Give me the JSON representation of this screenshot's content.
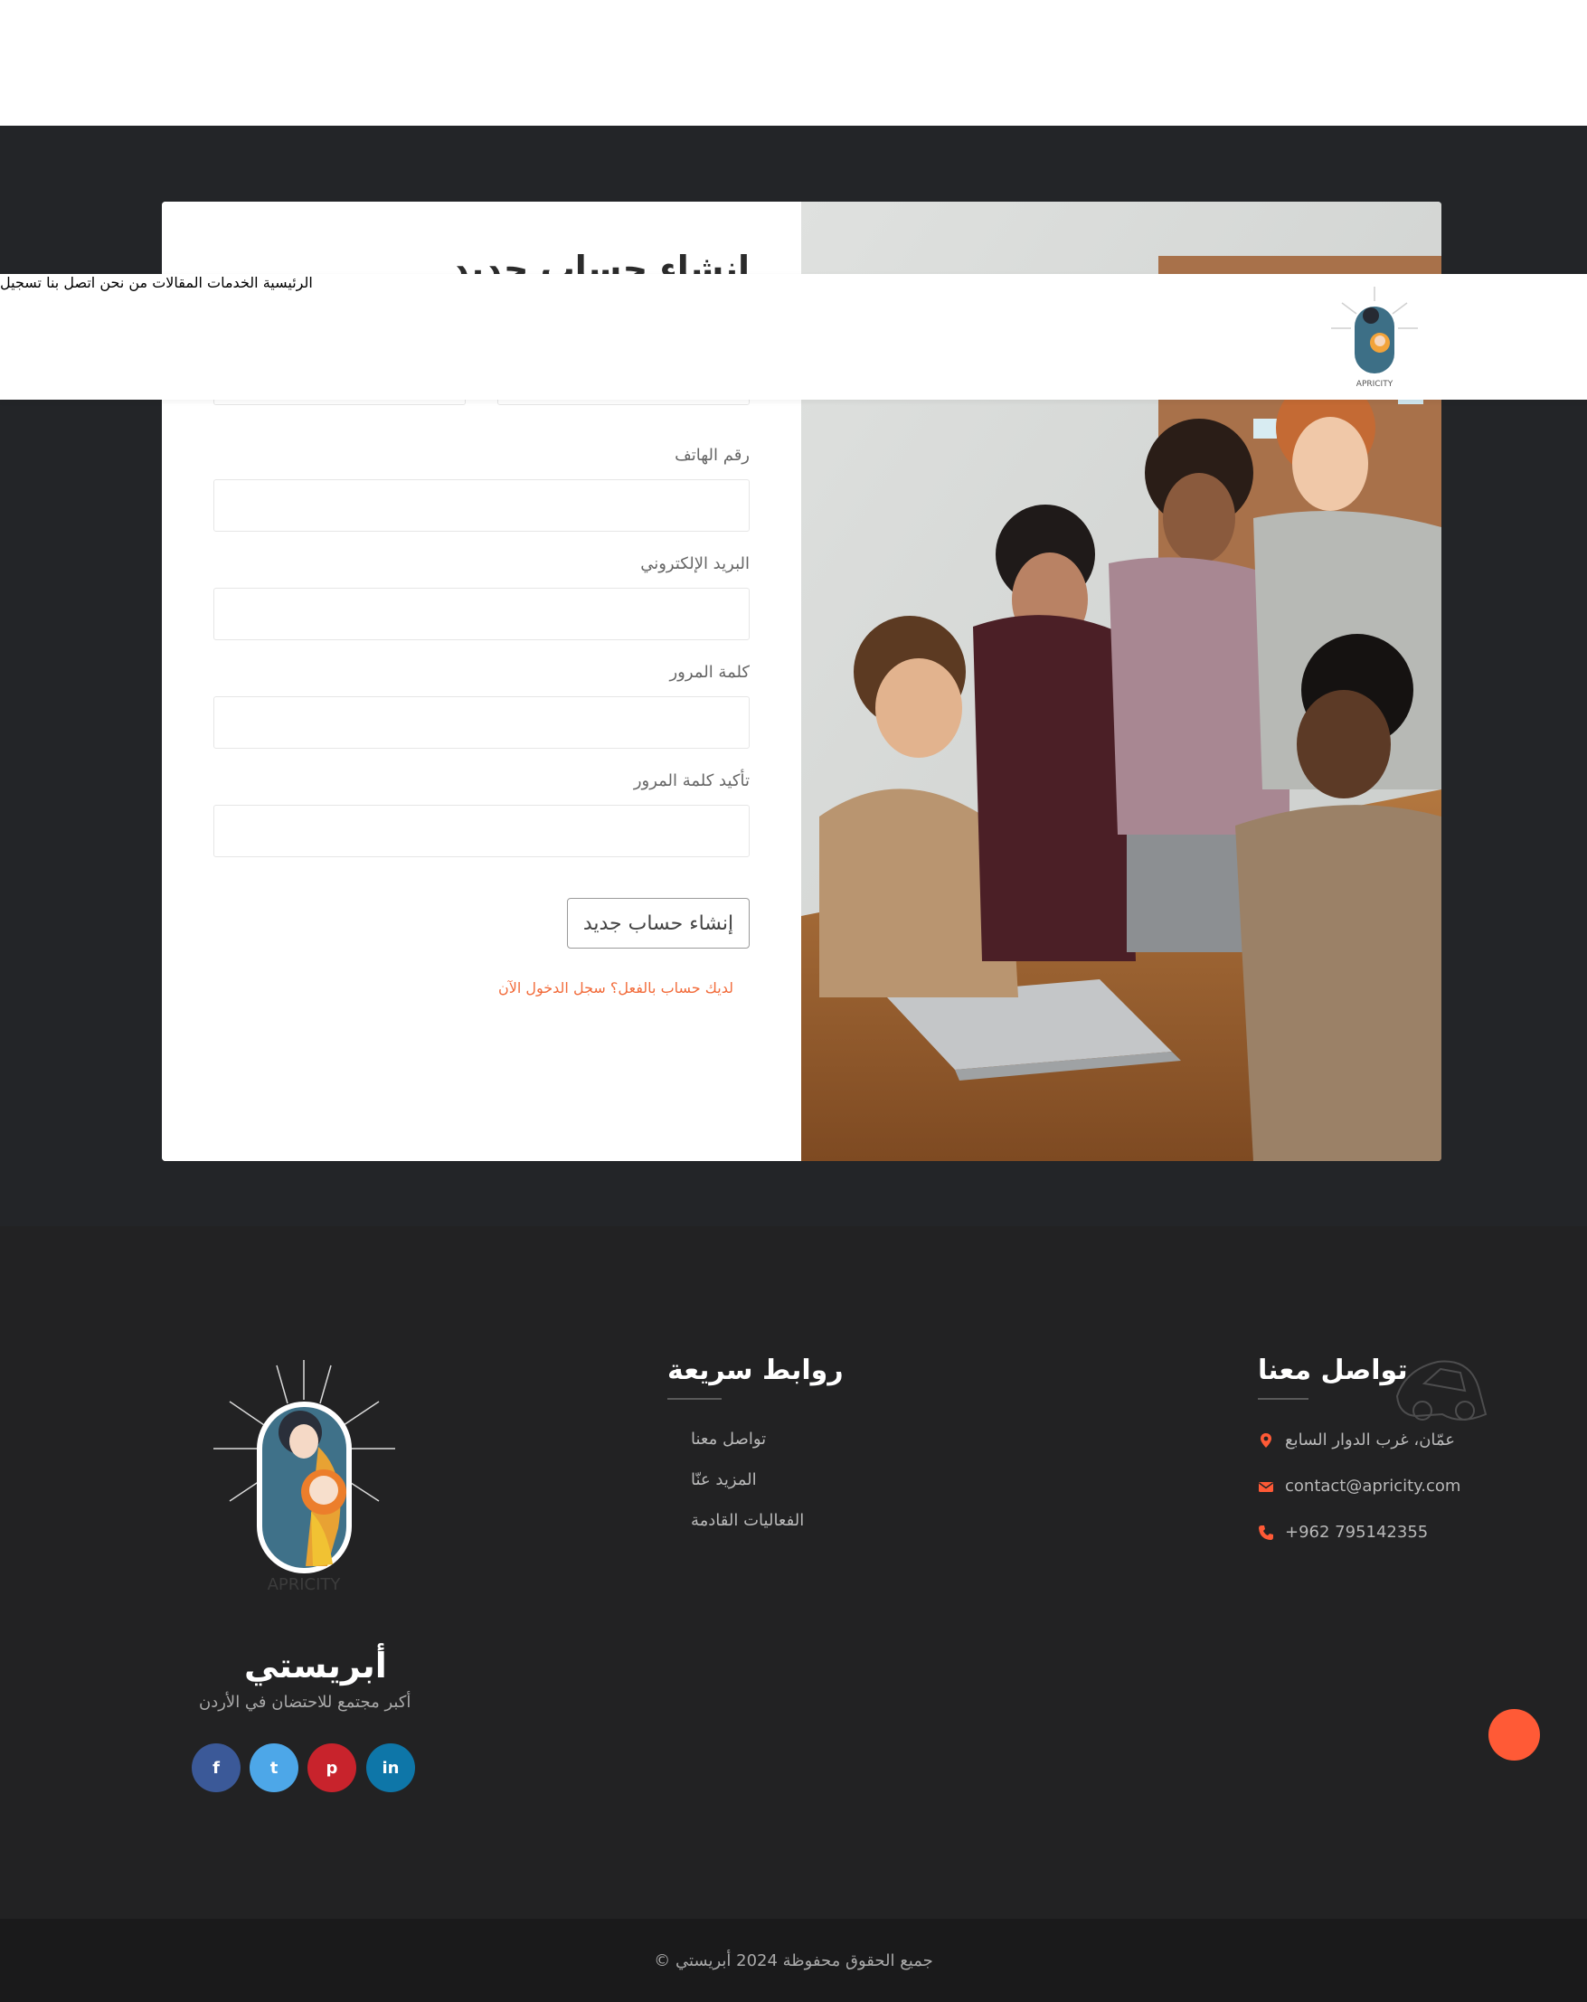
{
  "header": {
    "nav": [
      "الرئيسية",
      "الخدمات",
      "المقالات",
      "من نحن",
      "اتصل بنا",
      "تسجيل"
    ],
    "logo_text": "APRICITY"
  },
  "form": {
    "title": "إنشاء حساب جديد",
    "labels": {
      "phone": "رقم الهاتف",
      "email": "البريد الإلكتروني",
      "password": "كلمة المرور",
      "confirm_password": "تأكيد كلمة المرور"
    },
    "submit": "إنشاء حساب جديد",
    "login_link": "لديك حساب بالفعل؟ سجل الدخول الآن"
  },
  "footer": {
    "contact": {
      "title": "تواصل معنا",
      "address": "عمّان، غرب الدوار السابع",
      "email": "contact@apricity.com",
      "phone": "+962 795142355"
    },
    "quick_links": {
      "title": "روابط سريعة",
      "items": [
        "تواصل معنا",
        "المزيد عنّا",
        "الفعاليات القادمة"
      ]
    },
    "brand": {
      "name": "أبريستي",
      "tagline": "أكبر مجتمع للاحتضان في الأردن",
      "logo_text": "APRICITY"
    },
    "social": [
      "f",
      "t",
      "p",
      "in"
    ],
    "copyright": "جميع الحقوق محفوظة 2024 أبريستي ©"
  },
  "colors": {
    "accent": "#ff5a36",
    "link": "#f26b3a",
    "dark": "#232528",
    "facebook": "#3b5998",
    "twitter": "#4da7e8",
    "pinterest": "#c8232c",
    "linkedin": "#0e76a8"
  }
}
